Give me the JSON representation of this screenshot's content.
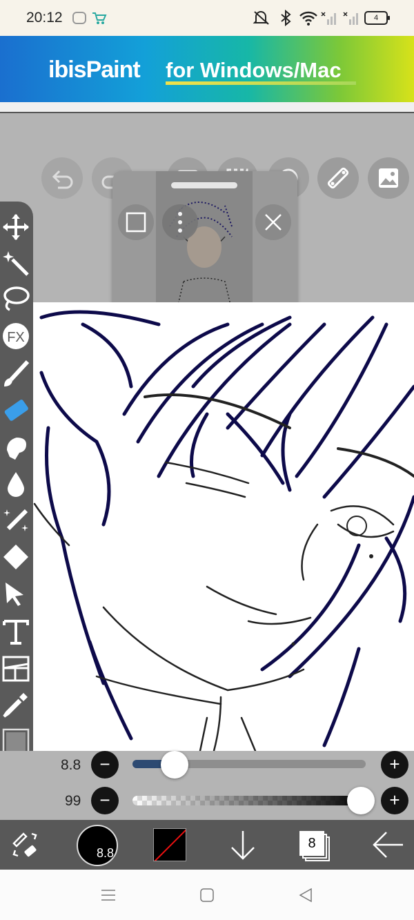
{
  "status_bar": {
    "time": "20:12",
    "battery": "4"
  },
  "banner": {
    "brand": "ibisPaint",
    "subtitle": "for Windows/Mac"
  },
  "sliders": {
    "brush_size": "8.8",
    "opacity": "99",
    "size_fraction": 0.18,
    "opacity_fraction": 0.98
  },
  "bottom_bar": {
    "brush_size_badge": "8.8",
    "layer_count": "8"
  },
  "icons": {
    "top_toolbar": [
      "undo-icon",
      "redo-icon",
      "camera-icon",
      "selection-icon",
      "transform-icon",
      "ruler-icon",
      "reference-image-icon"
    ],
    "left_toolbar": [
      "move-icon",
      "magic-wand-icon",
      "lasso-icon",
      "fx-icon",
      "brush-icon",
      "eraser-icon",
      "smudge-icon",
      "blur-icon",
      "special-brush-icon",
      "fill-icon",
      "select-icon",
      "text-icon",
      "frame-divider-icon",
      "eyedropper-icon",
      "canvas-icon"
    ]
  },
  "colors": {
    "line_art": "#0d0a4a",
    "accent": "#2d4a72"
  }
}
